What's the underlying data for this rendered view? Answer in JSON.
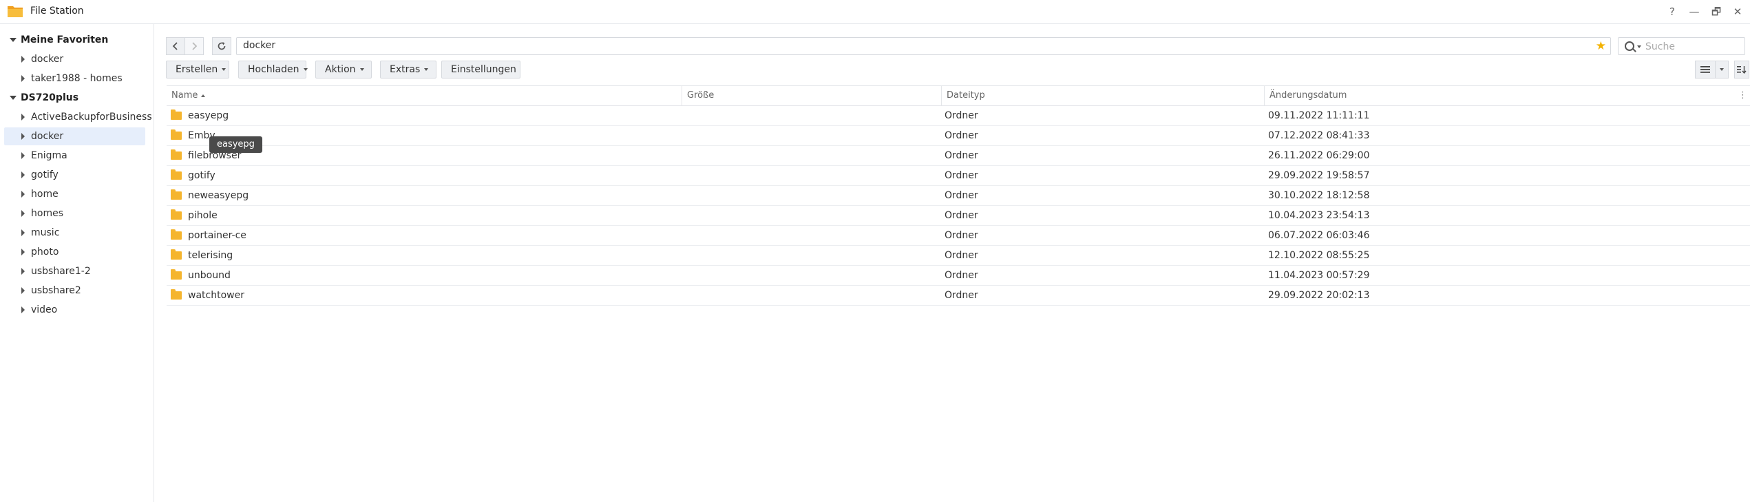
{
  "app": {
    "title": "File Station"
  },
  "window_controls": {
    "help": "?",
    "minimize": "—",
    "maximize": "🗗",
    "close": "✕"
  },
  "sidebar": {
    "groups": [
      {
        "label": "Meine Favoriten",
        "items": [
          "docker",
          "taker1988 - homes"
        ]
      },
      {
        "label": "DS720plus",
        "items": [
          "ActiveBackupforBusiness",
          "docker",
          "Enigma",
          "gotify",
          "home",
          "homes",
          "music",
          "photo",
          "usbshare1-2",
          "usbshare2",
          "video"
        ]
      }
    ],
    "selected": "docker"
  },
  "toolbar": {
    "path": "docker",
    "search_placeholder": "Suche",
    "buttons": [
      "Erstellen",
      "Hochladen",
      "Aktion",
      "Extras",
      "Einstellungen"
    ]
  },
  "columns": {
    "name": "Name",
    "size": "Größe",
    "type": "Dateityp",
    "modified": "Änderungsdatum"
  },
  "files": [
    {
      "name": "easyepg",
      "type": "Ordner",
      "modified": "09.11.2022 11:11:11"
    },
    {
      "name": "Emby",
      "type": "Ordner",
      "modified": "07.12.2022 08:41:33"
    },
    {
      "name": "filebrowser",
      "type": "Ordner",
      "modified": "26.11.2022 06:29:00"
    },
    {
      "name": "gotify",
      "type": "Ordner",
      "modified": "29.09.2022 19:58:57"
    },
    {
      "name": "neweasyepg",
      "type": "Ordner",
      "modified": "30.10.2022 18:12:58"
    },
    {
      "name": "pihole",
      "type": "Ordner",
      "modified": "10.04.2023 23:54:13"
    },
    {
      "name": "portainer-ce",
      "type": "Ordner",
      "modified": "06.07.2022 06:03:46"
    },
    {
      "name": "telerising",
      "type": "Ordner",
      "modified": "12.10.2022 08:55:25"
    },
    {
      "name": "unbound",
      "type": "Ordner",
      "modified": "11.04.2023 00:57:29"
    },
    {
      "name": "watchtower",
      "type": "Ordner",
      "modified": "29.09.2022 20:02:13"
    }
  ],
  "tooltip": "easyepg",
  "colors": {
    "star": "#f3b200",
    "folder": "#f5b52e",
    "selected_bg": "#e6eefb"
  }
}
